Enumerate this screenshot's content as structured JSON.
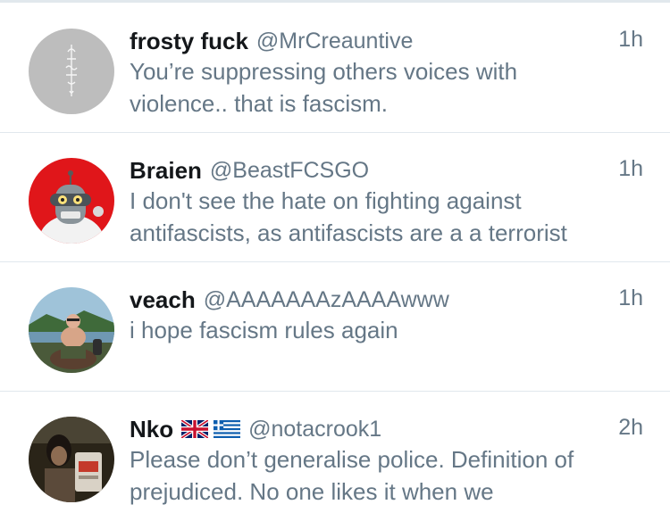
{
  "colors": {
    "name": "#14171a",
    "secondary": "#657786",
    "divider": "#e1e8ed",
    "background": "#ffffff"
  },
  "tweets": [
    {
      "name": "frosty fuck",
      "handle": "@MrCreauntive",
      "time": "1h",
      "lines": [
        "You’re suppressing others voices with",
        "violence.. that is fascism."
      ],
      "avatar_icon": "gray-glyph-avatar-icon",
      "flags": []
    },
    {
      "name": "Braien",
      "handle": "@BeastFCSGO",
      "time": "1h",
      "lines": [
        "I don't see the hate on fighting against",
        "antifascists, as antifascists are a a terrorist"
      ],
      "avatar_icon": "cartoon-robot-avatar-icon",
      "flags": []
    },
    {
      "name": "veach",
      "handle": "@AAAAAAAzAAAAwww",
      "time": "1h",
      "lines": [
        "i hope fascism rules again"
      ],
      "avatar_icon": "man-on-horse-photo-avatar-icon",
      "flags": []
    },
    {
      "name": "Nko",
      "handle": "@notacrook1",
      "time": "2h",
      "lines": [
        "Please don’t generalise police. Definition of",
        "prejudiced. No one likes it when we"
      ],
      "avatar_icon": "person-photo-avatar-icon",
      "flags": [
        "uk-flag-icon",
        "greece-flag-icon"
      ]
    }
  ]
}
